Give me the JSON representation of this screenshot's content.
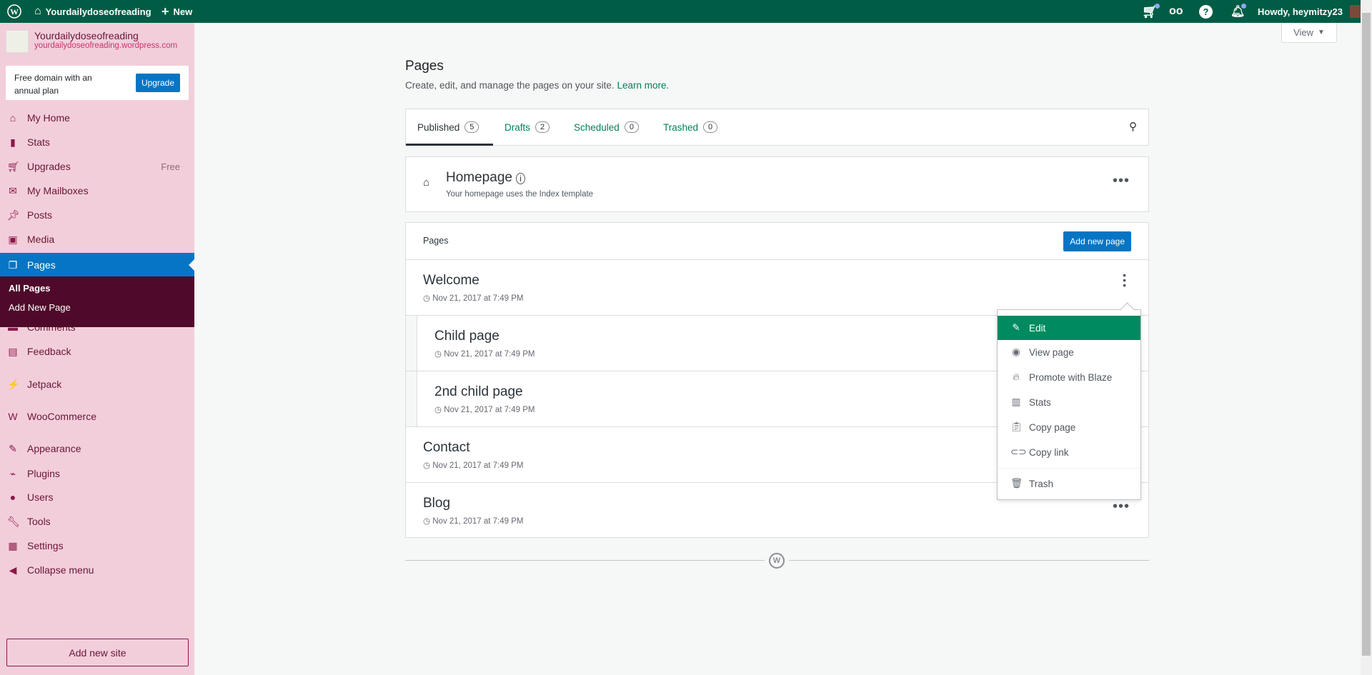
{
  "topbar": {
    "site_name": "Yourdailydoseofreading",
    "new_label": "New",
    "greeting": "Howdy, heymitzy23"
  },
  "sidebar": {
    "site_title": "Yourdailydoseofreading",
    "site_url": "yourdailydoseofreading.wordpress.com",
    "promo": {
      "text": "Free domain with an annual plan",
      "button": "Upgrade"
    },
    "items": [
      {
        "label": "My Home",
        "icon": "house-icon"
      },
      {
        "label": "Stats",
        "icon": "bar-chart-icon"
      },
      {
        "label": "Upgrades",
        "icon": "cart-icon",
        "badge": "Free"
      },
      {
        "label": "My Mailboxes",
        "icon": "mail-icon"
      },
      {
        "label": "Posts",
        "icon": "pin-icon"
      },
      {
        "label": "Media",
        "icon": "media-icon"
      },
      {
        "label": "Pages",
        "icon": "pages-icon"
      },
      {
        "label": "Comments",
        "icon": "comment-icon"
      },
      {
        "label": "Feedback",
        "icon": "feedback-icon"
      },
      {
        "label": "Jetpack",
        "icon": "jetpack-icon"
      },
      {
        "label": "WooCommerce",
        "icon": "woo-icon"
      },
      {
        "label": "Appearance",
        "icon": "brush-icon"
      },
      {
        "label": "Plugins",
        "icon": "plug-icon"
      },
      {
        "label": "Users",
        "icon": "user-icon"
      },
      {
        "label": "Tools",
        "icon": "wrench-icon"
      },
      {
        "label": "Settings",
        "icon": "settings-icon"
      },
      {
        "label": "Collapse menu",
        "icon": "collapse-icon"
      }
    ],
    "submenu": [
      "All Pages",
      "Add New Page"
    ],
    "add_site": "Add new site"
  },
  "view_button": "View",
  "main": {
    "title": "Pages",
    "subtitle": "Create, edit, and manage the pages on your site.",
    "learn_more": "Learn more.",
    "tabs": [
      {
        "label": "Published",
        "count": "5"
      },
      {
        "label": "Drafts",
        "count": "2"
      },
      {
        "label": "Scheduled",
        "count": "0"
      },
      {
        "label": "Trashed",
        "count": "0"
      }
    ],
    "homepage": {
      "title": "Homepage",
      "desc": "Your homepage uses the Index template"
    },
    "list_header": "Pages",
    "add_new": "Add new page",
    "pages": [
      {
        "title": "Welcome",
        "date": "Nov 21, 2017 at 7:49 PM"
      },
      {
        "title": "Child page",
        "date": "Nov 21, 2017 at 7:49 PM"
      },
      {
        "title": "2nd child page",
        "date": "Nov 21, 2017 at 7:49 PM"
      },
      {
        "title": "Contact",
        "date": "Nov 21, 2017 at 7:49 PM"
      },
      {
        "title": "Blog",
        "date": "Nov 21, 2017 at 7:49 PM"
      }
    ]
  },
  "menu": [
    "Edit",
    "View page",
    "Promote with Blaze",
    "Stats",
    "Copy page",
    "Copy link",
    "Trash"
  ]
}
